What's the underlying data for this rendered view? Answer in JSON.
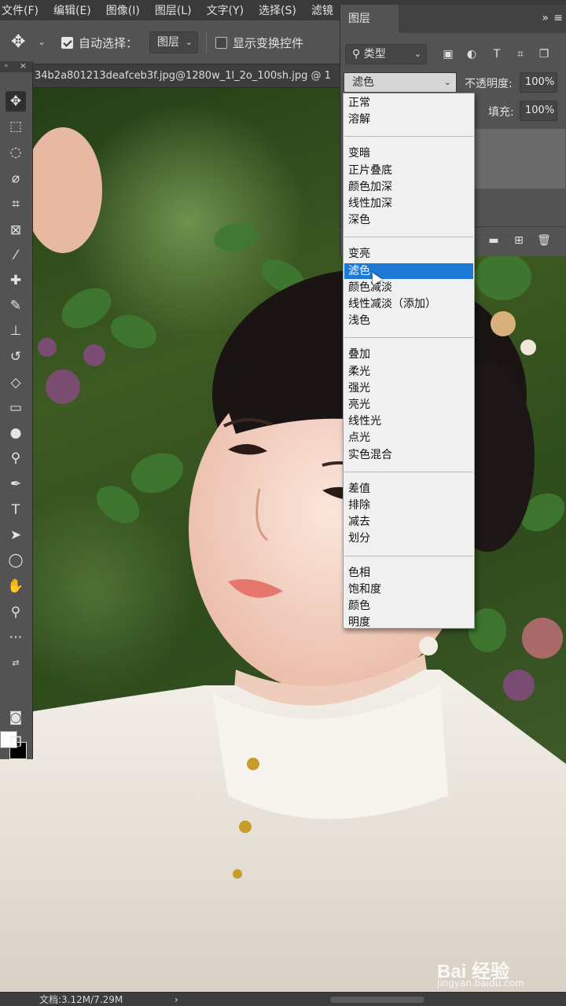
{
  "menubar": {
    "items": [
      "文件(F)",
      "编辑(E)",
      "图像(I)",
      "图层(L)",
      "文字(Y)",
      "选择(S)",
      "滤镜"
    ]
  },
  "options": {
    "auto_select_label": "自动选择：",
    "auto_select_checked": true,
    "target_value": "图层",
    "show_transform_label": "显示变换控件",
    "show_transform_checked": false
  },
  "document": {
    "tab_title": "34b2a801213deafceb3f.jpg@1280w_1l_2o_100sh.jpg @ 1"
  },
  "toolbar": {
    "tools": [
      "move-tool-icon",
      "marquee-tool-icon",
      "lasso-tool-icon",
      "quick-select-tool-icon",
      "crop-tool-icon",
      "frame-tool-icon",
      "eyedropper-tool-icon",
      "healing-brush-icon",
      "brush-tool-icon",
      "clone-stamp-icon",
      "history-brush-icon",
      "eraser-tool-icon",
      "gradient-tool-icon",
      "blur-tool-icon",
      "dodge-tool-icon",
      "pen-tool-icon",
      "type-tool-icon",
      "path-select-icon",
      "ellipse-tool-icon",
      "hand-tool-icon",
      "zoom-tool-icon",
      "more-tools-icon"
    ],
    "foreground_color": "#ffffff",
    "background_color": "#000000"
  },
  "layers_panel": {
    "tab_label": "图层",
    "filter_label": "类型",
    "blend_mode_value": "滤色",
    "opacity_label": "不透明度:",
    "opacity_value": "100%",
    "fill_label": "填充:",
    "fill_value": "100%"
  },
  "blend_dropdown": {
    "selected": "滤色",
    "groups": [
      [
        "正常",
        "溶解"
      ],
      [
        "变暗",
        "正片叠底",
        "颜色加深",
        "线性加深",
        "深色"
      ],
      [
        "变亮",
        "滤色",
        "颜色减淡",
        "线性减淡（添加）",
        "浅色"
      ],
      [
        "叠加",
        "柔光",
        "强光",
        "亮光",
        "线性光",
        "点光",
        "实色混合"
      ],
      [
        "差值",
        "排除",
        "减去",
        "划分"
      ],
      [
        "色相",
        "饱和度",
        "颜色",
        "明度"
      ]
    ]
  },
  "status": {
    "doc_size": "文档:3.12M/7.29M"
  },
  "watermark": {
    "main": "Bai 经验",
    "sub": "jingyan.baidu.com"
  },
  "colors": {
    "accent_selected": "#1e78d6",
    "panel_bg": "#535353",
    "menubar_bg": "#3a3a3a"
  }
}
